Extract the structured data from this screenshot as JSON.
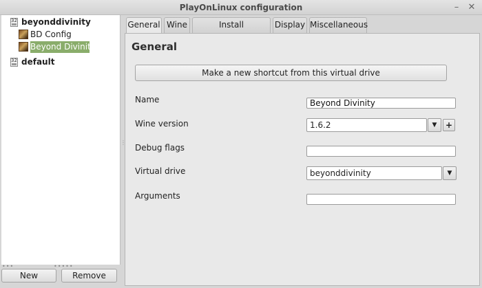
{
  "window": {
    "title": "PlayOnLinux configuration",
    "minimize_glyph": "–",
    "close_glyph": "✕"
  },
  "tree": {
    "items": [
      {
        "label": "beyonddivinity",
        "prefix": "32",
        "bold": true
      },
      {
        "label": "BD Config",
        "icon": "app-icon"
      },
      {
        "label": "Beyond Divinity",
        "icon": "app-icon",
        "selected": true
      },
      {
        "label": "default",
        "prefix": "32",
        "bold": true
      }
    ]
  },
  "buttons": {
    "new": "New",
    "remove": "Remove"
  },
  "tabs": [
    {
      "label": "General",
      "active": true
    },
    {
      "label": "Wine"
    },
    {
      "label": "Install components"
    },
    {
      "label": "Display"
    },
    {
      "label": "Miscellaneous"
    }
  ],
  "general": {
    "heading": "General",
    "shortcut_button": "Make a new shortcut from this virtual drive",
    "name_label": "Name",
    "name_value": "Beyond Divinity",
    "wine_version_label": "Wine version",
    "wine_version_value": "1.6.2",
    "plus_glyph": "+",
    "debug_flags_label": "Debug flags",
    "debug_flags_value": "",
    "virtual_drive_label": "Virtual drive",
    "virtual_drive_value": "beyonddivinity",
    "arguments_label": "Arguments",
    "arguments_value": "",
    "dropdown_glyph": "▼"
  },
  "colors": {
    "selection": "#8aad6b",
    "panel": "#e9e9e9",
    "background": "#d6d6d6"
  }
}
